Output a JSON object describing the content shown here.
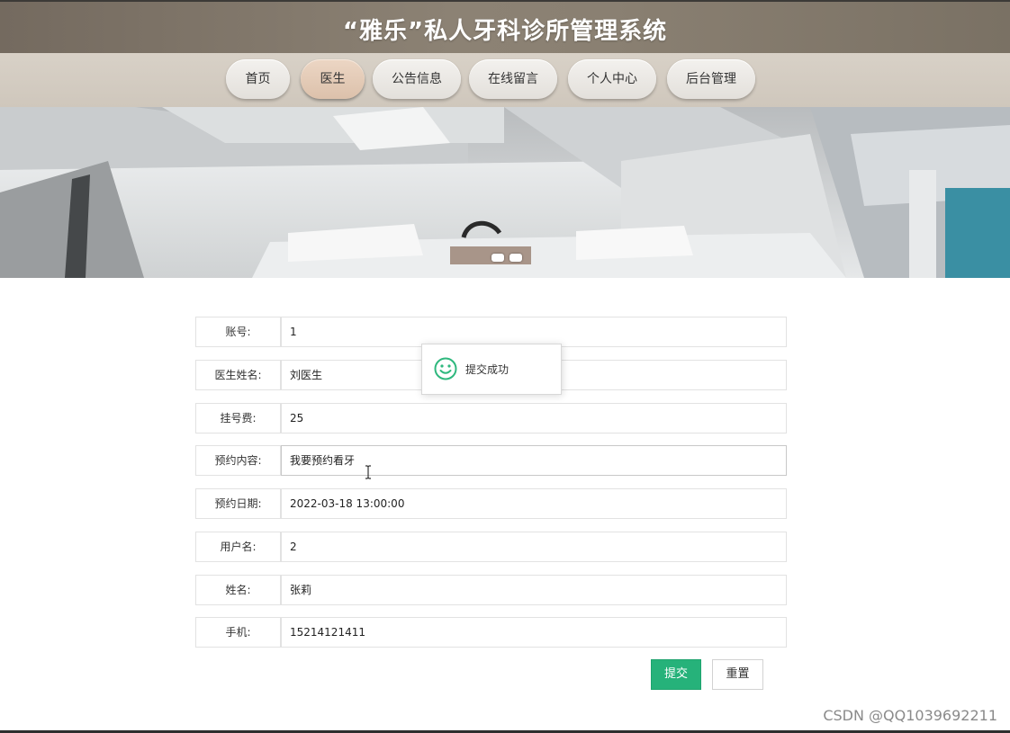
{
  "header": {
    "title": "“雅乐”私人牙科诊所管理系统"
  },
  "nav": {
    "items": [
      {
        "label": "首页"
      },
      {
        "label": "医生",
        "active": true
      },
      {
        "label": "公告信息"
      },
      {
        "label": "在线留言"
      },
      {
        "label": "个人中心"
      },
      {
        "label": "后台管理"
      }
    ]
  },
  "banner": {
    "carousel_total": 2,
    "carousel_active": 1
  },
  "form": {
    "fields": [
      {
        "label": "账号:",
        "value": "1"
      },
      {
        "label": "医生姓名:",
        "value": "刘医生"
      },
      {
        "label": "挂号费:",
        "value": "25"
      },
      {
        "label": "预约内容:",
        "value": "我要预约看牙"
      },
      {
        "label": "预约日期:",
        "value": "2022-03-18 13:00:00"
      },
      {
        "label": "用户名:",
        "value": "2"
      },
      {
        "label": "姓名:",
        "value": "张莉"
      },
      {
        "label": "手机:",
        "value": "15214121411"
      }
    ],
    "submit_label": "提交",
    "reset_label": "重置"
  },
  "toast": {
    "message": "提交成功",
    "icon": "smile-icon"
  },
  "watermark": "CSDN @QQ1039692211",
  "colors": {
    "header_bg": "#8c8274",
    "nav_bg": "#d3ccc2",
    "nav_active": "#e3cab6",
    "submit_green": "#26b27a",
    "toast_icon_green": "#2fb87e"
  }
}
